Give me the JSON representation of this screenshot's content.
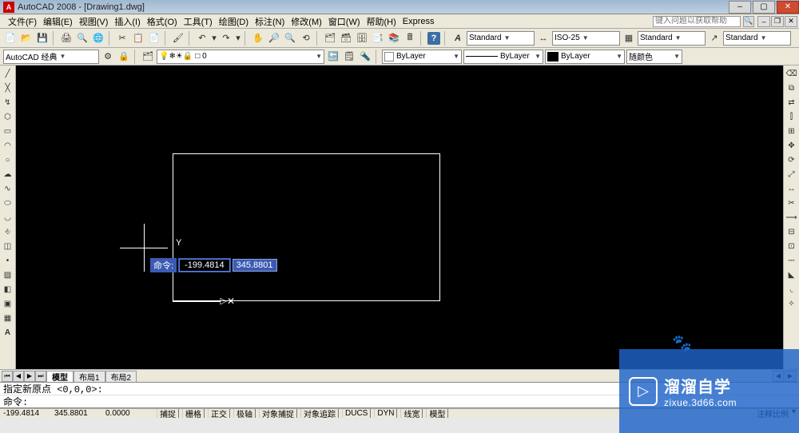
{
  "titlebar": {
    "app": "AutoCAD 2008 - [Drawing1.dwg]"
  },
  "menubar": {
    "items": [
      "文件(F)",
      "编辑(E)",
      "视图(V)",
      "插入(I)",
      "格式(O)",
      "工具(T)",
      "绘图(D)",
      "标注(N)",
      "修改(M)",
      "窗口(W)",
      "帮助(H)",
      "Express"
    ],
    "help_placeholder": "键入问题以获取帮助"
  },
  "toolbar1": {
    "std_style": "Standard",
    "dim_style": "ISO-25",
    "tbl_style": "Standard",
    "mls_style": "Standard"
  },
  "workspace": {
    "name": "AutoCAD 经典",
    "layer_dd": "□ 0",
    "layer_state_icons": "💡❄☀🔒",
    "tr_color": "随颜色",
    "color_dd": "ByLayer",
    "ltype_dd": "ByLayer",
    "lweight_dd": "ByLayer"
  },
  "dyn": {
    "cmd_label": "命令:",
    "x": "-199.4814",
    "y": "345.8801"
  },
  "axis": {
    "y_label": "Y"
  },
  "tabs": {
    "model": "模型",
    "layout1": "布局1",
    "layout2": "布局2"
  },
  "cmd": {
    "hist": "指定新原点 <0,0,0>:",
    "prompt": "命令:"
  },
  "status": {
    "coord_x": "-199.4814",
    "coord_y": "345.8801",
    "coord_z": "0.0000",
    "btns": [
      "捕捉",
      "栅格",
      "正交",
      "极轴",
      "对象捕捉",
      "对象追踪",
      "DUCS",
      "DYN",
      "线宽",
      "模型"
    ],
    "right": "注释比例"
  },
  "overlay": {
    "cn": "溜溜自学",
    "en": "zixue.3d66.com"
  }
}
